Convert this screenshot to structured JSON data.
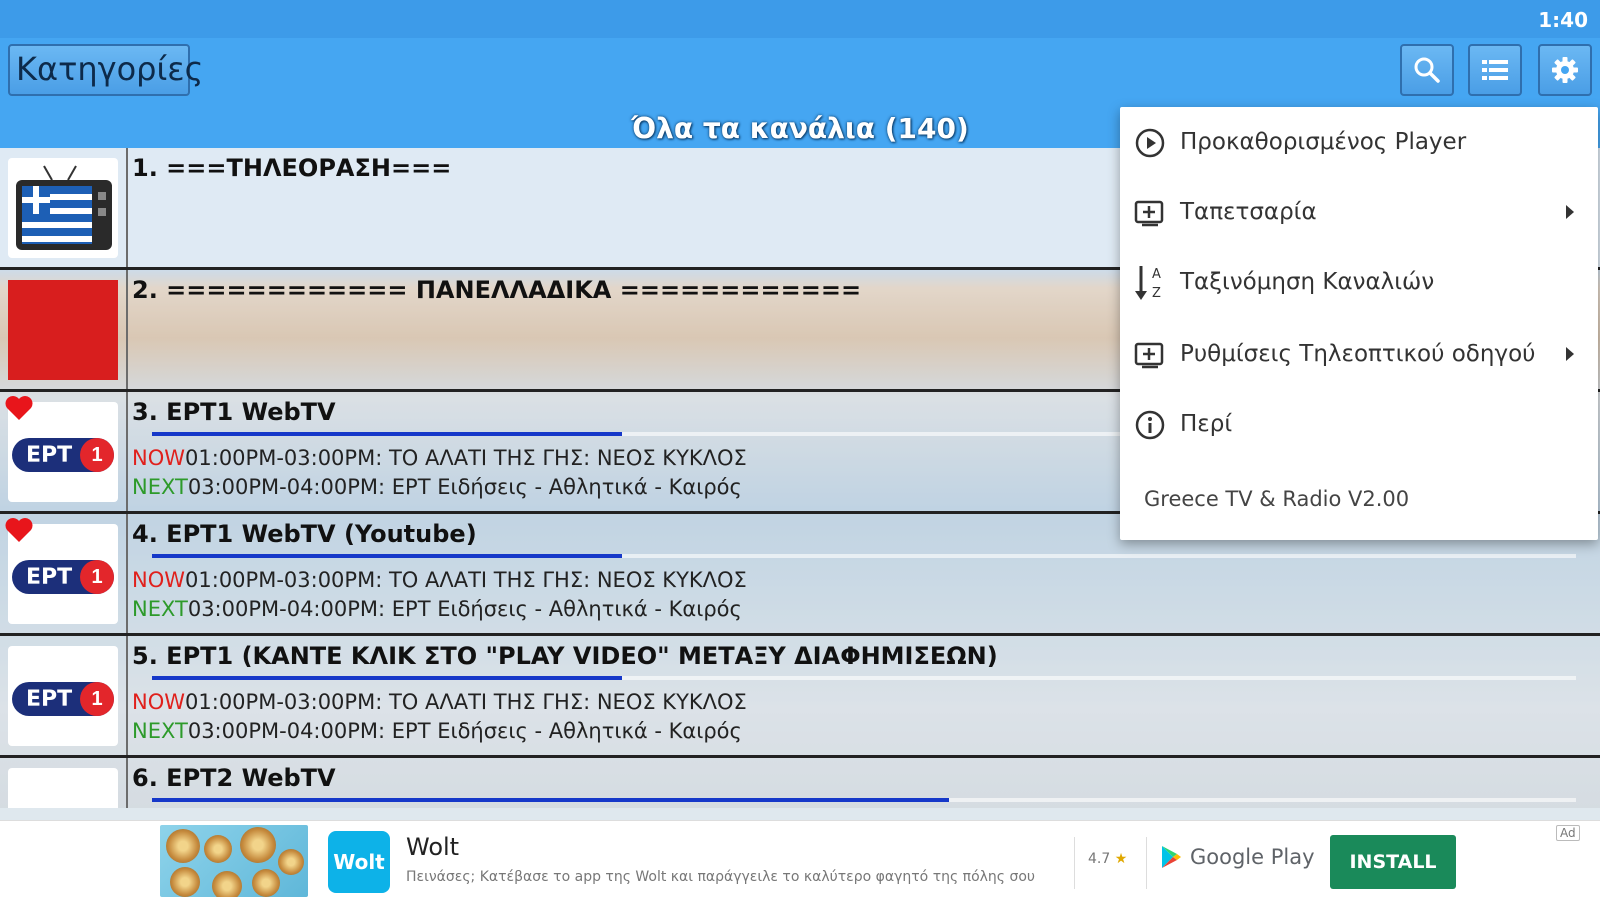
{
  "status_bar": {
    "time": "1:40"
  },
  "app_bar": {
    "categories_label": "Κατηγορίες",
    "list_title": "Όλα τα κανάλια (140)"
  },
  "channels": [
    {
      "name": "1. ===ΤΗΛΕΟΡΑΣΗ===",
      "favorite": false
    },
    {
      "name": "2. ============ ΠΑΝΕΛΛΑΔΙΚΑ ============",
      "favorite": false
    },
    {
      "name": "3. ΕΡΤ1 WebTV",
      "favorite": true,
      "progress": 0.33,
      "now_label": "NOW",
      "now_text": "01:00PM-03:00PM: ΤΟ ΑΛΑΤΙ ΤΗΣ ΓΗΣ: ΝΕΟΣ ΚΥΚΛΟΣ",
      "next_label": "NEXT",
      "next_text": "03:00PM-04:00PM: ΕΡΤ Ειδήσεις - Αθλητικά - Καιρός"
    },
    {
      "name": "4. ΕΡΤ1 WebTV (Youtube)",
      "favorite": true,
      "progress": 0.33,
      "now_label": "NOW",
      "now_text": "01:00PM-03:00PM: ΤΟ ΑΛΑΤΙ ΤΗΣ ΓΗΣ: ΝΕΟΣ ΚΥΚΛΟΣ",
      "next_label": "NEXT",
      "next_text": "03:00PM-04:00PM: ΕΡΤ Ειδήσεις - Αθλητικά - Καιρός"
    },
    {
      "name": "5. ΕΡΤ1 (ΚΑΝΤΕ ΚΛΙΚ ΣΤΟ \"PLAY VIDEO\" ΜΕΤΑΞΥ ΔΙΑΦΗΜΙΣΕΩΝ)",
      "favorite": false,
      "progress": 0.33,
      "now_label": "NOW",
      "now_text": "01:00PM-03:00PM: ΤΟ ΑΛΑΤΙ ΤΗΣ ΓΗΣ: ΝΕΟΣ ΚΥΚΛΟΣ",
      "next_label": "NEXT",
      "next_text": "03:00PM-04:00PM: ΕΡΤ Ειδήσεις - Αθλητικά - Καιρός"
    },
    {
      "name": "6. ΕΡΤ2 WebTV",
      "favorite": false,
      "progress": 0.56
    }
  ],
  "logos": {
    "ert_text": "ΕΡΤ",
    "ert_number": "1"
  },
  "menu": {
    "items": [
      {
        "label": "Προκαθορισμένος Player",
        "icon": "play-circle-icon",
        "submenu": false
      },
      {
        "label": "Ταπετσαρία",
        "icon": "wallpaper-icon",
        "submenu": true
      },
      {
        "label": "Ταξινόμηση Καναλιών",
        "icon": "sort-az-icon",
        "submenu": false
      },
      {
        "label": "Ρυθμίσεις Τηλεοπτικού οδηγού",
        "icon": "tv-guide-icon",
        "submenu": true
      },
      {
        "label": "Περί",
        "icon": "info-icon",
        "submenu": false
      }
    ],
    "version": "Greece TV & Radio V2.00"
  },
  "ad": {
    "app_logo_text": "Wolt",
    "name": "Wolt",
    "description": "Πεινάσες; Κατέβασε το app της Wolt και παράγγειλε το καλύτερο φαγητό της πόλης σου",
    "rating": "4.7",
    "store": "Google Play",
    "install_label": "INSTALL",
    "badge": "Ad"
  },
  "colors": {
    "status_bar": "#3d9be9",
    "app_bar": "#45a6f2",
    "progress": "#1638c9",
    "now": "#e0201c",
    "next": "#2d9a2a",
    "install": "#1a8a5a"
  }
}
